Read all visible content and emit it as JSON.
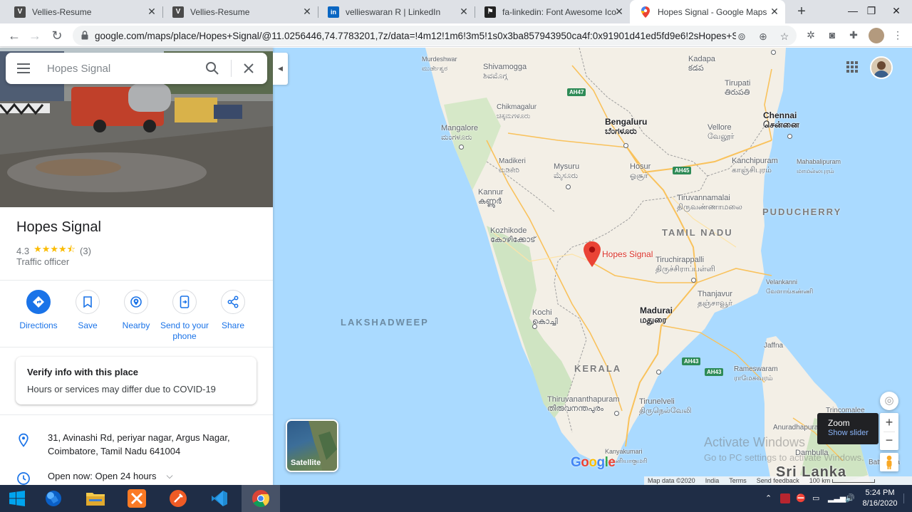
{
  "browser": {
    "tabs": [
      {
        "title": "Vellies-Resume",
        "icon": "vellies-favicon"
      },
      {
        "title": "Vellies-Resume",
        "icon": "vellies-favicon"
      },
      {
        "title": "vellieswaran R | LinkedIn",
        "icon": "linkedin-favicon"
      },
      {
        "title": "fa-linkedin: Font Awesome Icon",
        "icon": "font-awesome-favicon"
      },
      {
        "title": "Hopes Signal - Google Maps",
        "icon": "google-maps-favicon",
        "active": true
      }
    ],
    "url": "google.com/maps/place/Hopes+Signal/@11.0256446,74.7783201,7z/data=!4m12!1m6!3m5!1s0x3ba857943950ca4f:0x91901d41ed5fd9e6!2sHopes+Sig..."
  },
  "search": {
    "placeholder": "Hopes Signal",
    "value": ""
  },
  "place": {
    "name": "Hopes Signal",
    "rating": "4.3",
    "stars": "★★★★⯪",
    "review_count": "(3)",
    "category": "Traffic officer",
    "actions": [
      "Directions",
      "Save",
      "Nearby",
      "Send to your phone",
      "Share"
    ],
    "covid_card": {
      "heading": "Verify info with this place",
      "body": "Hours or services may differ due to COVID-19"
    },
    "address_line1": "31, Avinashi Rd, periyar nagar, Argus Nagar,",
    "address_line2": "Coimbatore, Tamil Nadu 641004",
    "hours": "Open now:  Open 24 hours"
  },
  "map": {
    "pin_label": "Hopes Signal",
    "regions": [
      "TAMIL NADU",
      "KERALA",
      "PUDUCHERRY"
    ],
    "seas": [
      "LAKSHADWEEP"
    ],
    "cities": [
      {
        "name": "Murdeshwar",
        "local": "ಮುರ್ಡೇಶ್ವರ"
      },
      {
        "name": "Shivamogga",
        "local": "ಶಿವಮೊಗ್ಗ"
      },
      {
        "name": "Kadapa",
        "local": "కడప"
      },
      {
        "name": "Tirupati",
        "local": "తిరుపతి"
      },
      {
        "name": "Chikmagalur",
        "local": "ಚಿಕ್ಕಮಗಳೂರು"
      },
      {
        "name": "Bengaluru",
        "local": "ಬೆಂಗಳೂರು"
      },
      {
        "name": "Chennai",
        "local": "சென்னை"
      },
      {
        "name": "Mangalore",
        "local": "ಮಂಗಳೂರು"
      },
      {
        "name": "Vellore",
        "local": "வேலூர்"
      },
      {
        "name": "Madikeri",
        "local": "ಮಡಿಕೇರಿ"
      },
      {
        "name": "Mysuru",
        "local": "ಮೈಸೂರು"
      },
      {
        "name": "Hosur",
        "local": "ஓசூர்"
      },
      {
        "name": "Kanchipuram",
        "local": "காஞ்சிபுரம்"
      },
      {
        "name": "Mahabalipuram",
        "local": "மாமல்லபுரம்"
      },
      {
        "name": "Kannur",
        "local": "കണ്ണൂർ"
      },
      {
        "name": "Tiruvannamalai",
        "local": "திருவண்ணாமலை"
      },
      {
        "name": "Kozhikode",
        "local": "കോഴിക്കോട്"
      },
      {
        "name": "Tiruchirappalli",
        "local": "திருச்சிராப்பள்ளி"
      },
      {
        "name": "Velankanni",
        "local": "வேளாங்கண்ணி"
      },
      {
        "name": "Thanjavur",
        "local": "தஞ்சாவூர்"
      },
      {
        "name": "Kochi",
        "local": "കൊച്ചി"
      },
      {
        "name": "Madurai",
        "local": "மதுரை"
      },
      {
        "name": "Jaffna"
      },
      {
        "name": "Rameswaram",
        "local": "ராமேசுவரம்"
      },
      {
        "name": "Thiruvananthapuram",
        "local": "തിരുവനന്തപുരം"
      },
      {
        "name": "Tirunelveli",
        "local": "திருநெல்வேலி"
      },
      {
        "name": "Kanyakumari",
        "local": "கன்னியாகுமரி"
      },
      {
        "name": "Trincomalee"
      },
      {
        "name": "Anuradhapura"
      },
      {
        "name": "Dambulla"
      },
      {
        "name": "Batticaloa"
      },
      {
        "name": "Sri Lanka"
      }
    ],
    "highways": [
      "AH47",
      "AH45",
      "AH43",
      "AH43"
    ],
    "satellite_label": "Satellite",
    "zoom_tooltip": {
      "title": "Zoom",
      "sub": "Show slider"
    },
    "google_logo": "Google",
    "attribution": [
      "Map data ©2020",
      "India",
      "Terms",
      "Send feedback",
      "100 km"
    ],
    "activate_windows": {
      "title": "Activate Windows",
      "sub": "Go to PC settings to activate Windows."
    }
  },
  "taskbar": {
    "time": "5:24 PM",
    "date": "8/16/2020"
  }
}
